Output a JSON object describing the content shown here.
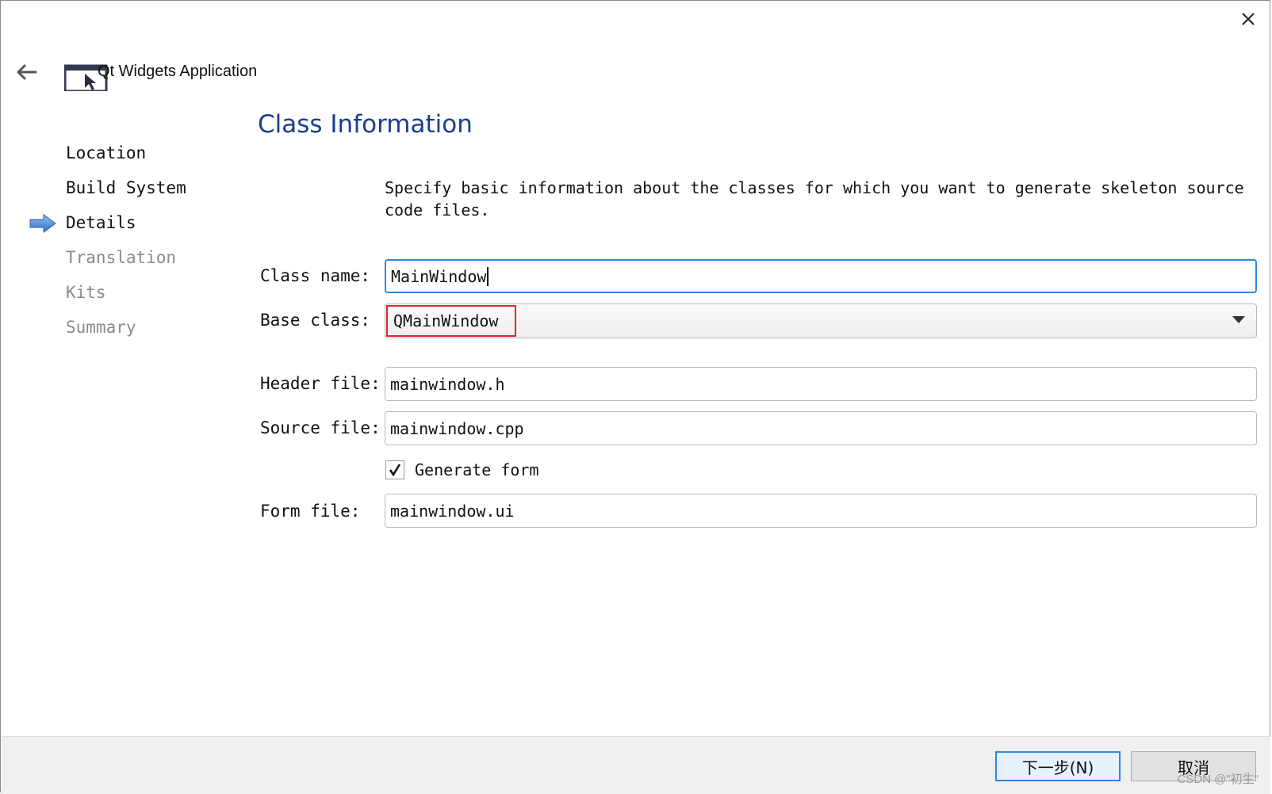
{
  "window": {
    "close_icon": "close-icon",
    "back_icon": "back-arrow-icon",
    "app_icon": "app-window-icon",
    "app_title": "Qt Widgets Application"
  },
  "steps": [
    {
      "label": "Location",
      "state": "done"
    },
    {
      "label": "Build System",
      "state": "done"
    },
    {
      "label": "Details",
      "state": "current"
    },
    {
      "label": "Translation",
      "state": "pending"
    },
    {
      "label": "Kits",
      "state": "pending"
    },
    {
      "label": "Summary",
      "state": "pending"
    }
  ],
  "page": {
    "title": "Class Information",
    "description": "Specify basic information about the classes for which you want to generate skeleton source code files."
  },
  "form": {
    "class_name_label": "Class name:",
    "class_name_value": "MainWindow",
    "base_class_label": "Base class:",
    "base_class_value": "QMainWindow",
    "header_file_label": "Header file:",
    "header_file_value": "mainwindow.h",
    "source_file_label": "Source file:",
    "source_file_value": "mainwindow.cpp",
    "generate_form_label": "Generate form",
    "generate_form_checked": true,
    "form_file_label": "Form file:",
    "form_file_value": "mainwindow.ui"
  },
  "footer": {
    "next_label": "下一步(N)",
    "cancel_label": "取消"
  },
  "watermark": "CSDN @\"初生\"",
  "colors": {
    "title": "#1a3f8f",
    "focus_border": "#2f86e0",
    "highlight": "#e3262e",
    "current_step_arrow": "#3b7fd6"
  }
}
